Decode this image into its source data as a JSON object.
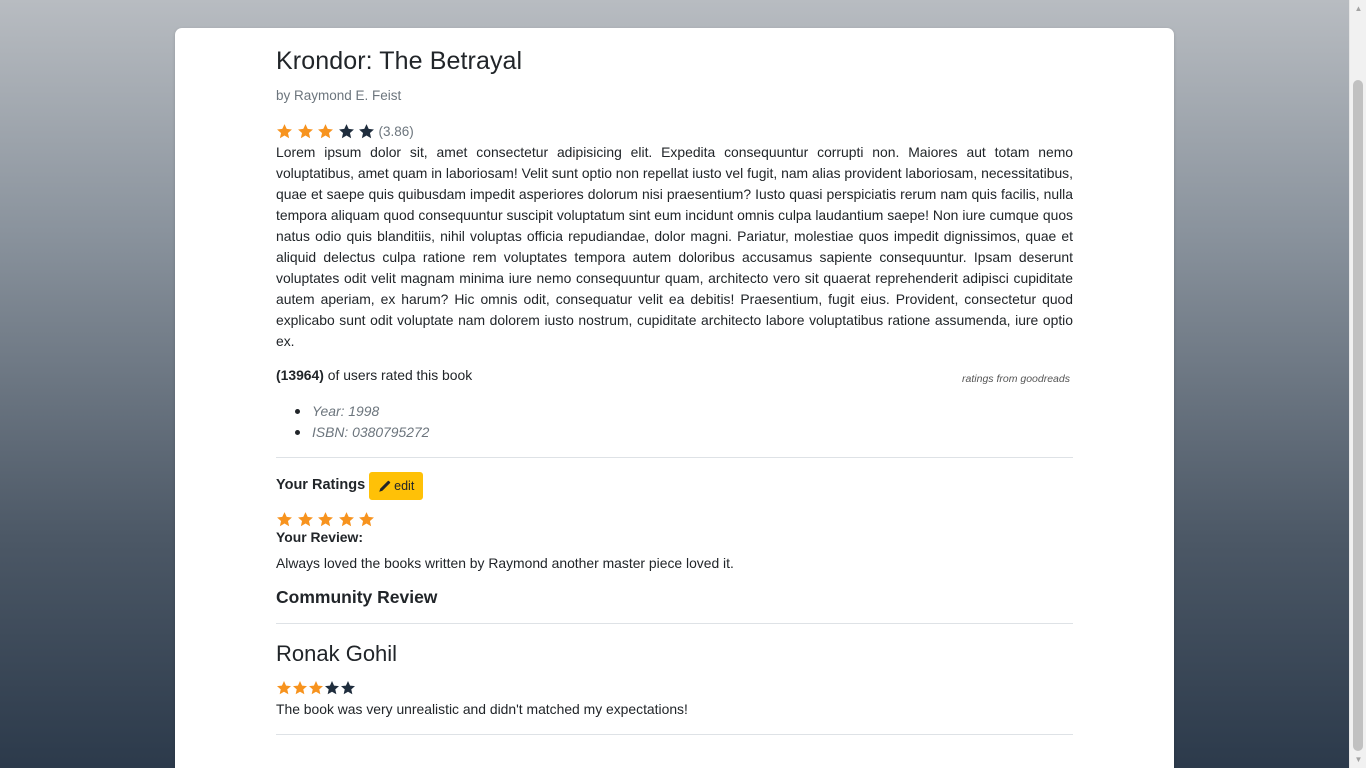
{
  "colors": {
    "star_filled": "#f7931e",
    "star_empty": "#1f2d3d",
    "edit_button_bg": "#ffc107",
    "muted_text": "#6c757d"
  },
  "book": {
    "title": "Krondor: The Betrayal",
    "author": "by Raymond E. Feist",
    "average_rating": 3.86,
    "average_rating_label": "(3.86)",
    "average_stars_filled": 3,
    "average_stars_total": 5,
    "description": "Lorem ipsum dolor sit, amet consectetur adipisicing elit. Expedita consequuntur corrupti non. Maiores aut totam nemo voluptatibus, amet quam in laboriosam! Velit sunt optio non repellat iusto vel fugit, nam alias provident laboriosam, necessitatibus, quae et saepe quis quibusdam impedit asperiores dolorum nisi praesentium? Iusto quasi perspiciatis rerum nam quis facilis, nulla tempora aliquam quod consequuntur suscipit voluptatum sint eum incidunt omnis culpa laudantium saepe! Non iure cumque quos natus odio quis blanditiis, nihil voluptas officia repudiandae, dolor magni. Pariatur, molestiae quos impedit dignissimos, quae et aliquid delectus culpa ratione rem voluptates tempora autem doloribus accusamus sapiente consequuntur. Ipsam deserunt voluptates odit velit magnam minima iure nemo consequuntur quam, architecto vero sit quaerat reprehenderit adipisci cupiditate autem aperiam, ex harum? Hic omnis odit, consequatur velit ea debitis! Praesentium, fugit eius. Provident, consectetur quod explicabo sunt odit voluptate nam dolorem iusto nostrum, cupiditate architecto labore voluptatibus ratione assumenda, iure optio ex.",
    "ratings_count": "(13964)",
    "ratings_count_suffix": " of users rated this book",
    "ratings_source": "ratings from goodreads",
    "year": "Year: 1998",
    "isbn": "ISBN: 0380795272"
  },
  "user_rating": {
    "label": "Your Ratings",
    "edit_label": "edit",
    "stars_filled": 5,
    "stars_total": 5,
    "review_label": "Your Review:",
    "review_text": "Always loved the books written by Raymond another master piece loved it."
  },
  "community": {
    "title": "Community Review",
    "reviews": [
      {
        "name": "Ronak Gohil",
        "stars_filled": 3,
        "stars_total": 5,
        "text": "The book was very unrealistic and didn't matched my expectations!"
      }
    ]
  }
}
